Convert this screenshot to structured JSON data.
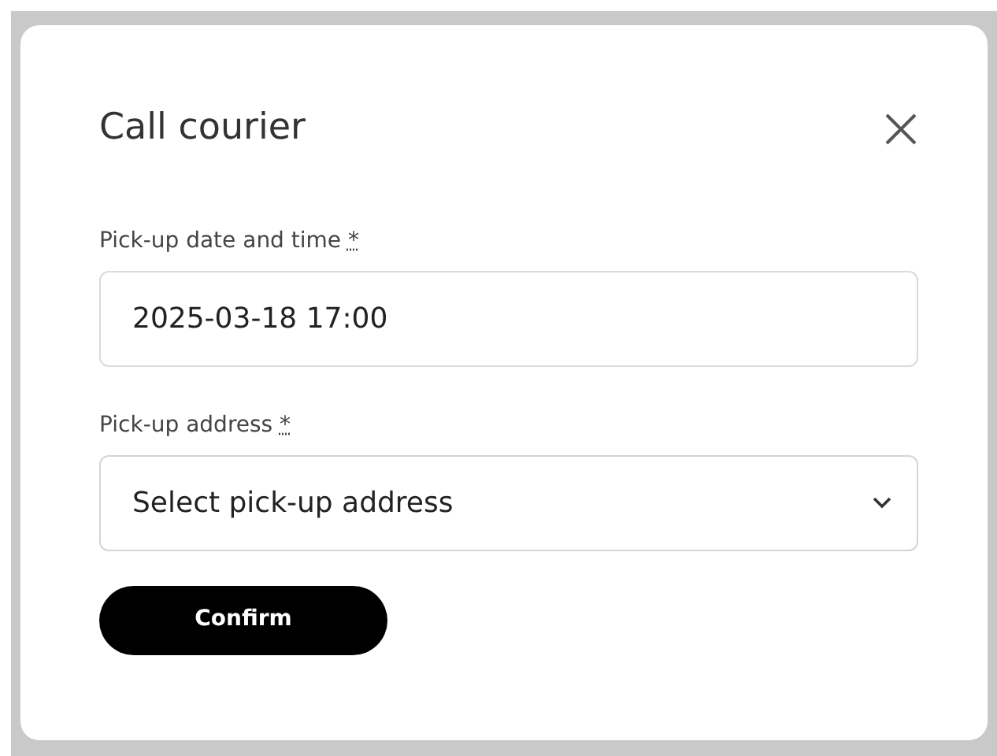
{
  "dialog": {
    "title": "Call courier"
  },
  "fields": [
    {
      "kind": "text",
      "label": "Pick-up date and time",
      "required_mark": "*",
      "value": "2025-03-18 17:00"
    },
    {
      "kind": "select",
      "label": "Pick-up address",
      "required_mark": "*",
      "placeholder": "Select pick-up address"
    }
  ],
  "buttons": [
    {
      "label": "Confirm"
    }
  ]
}
